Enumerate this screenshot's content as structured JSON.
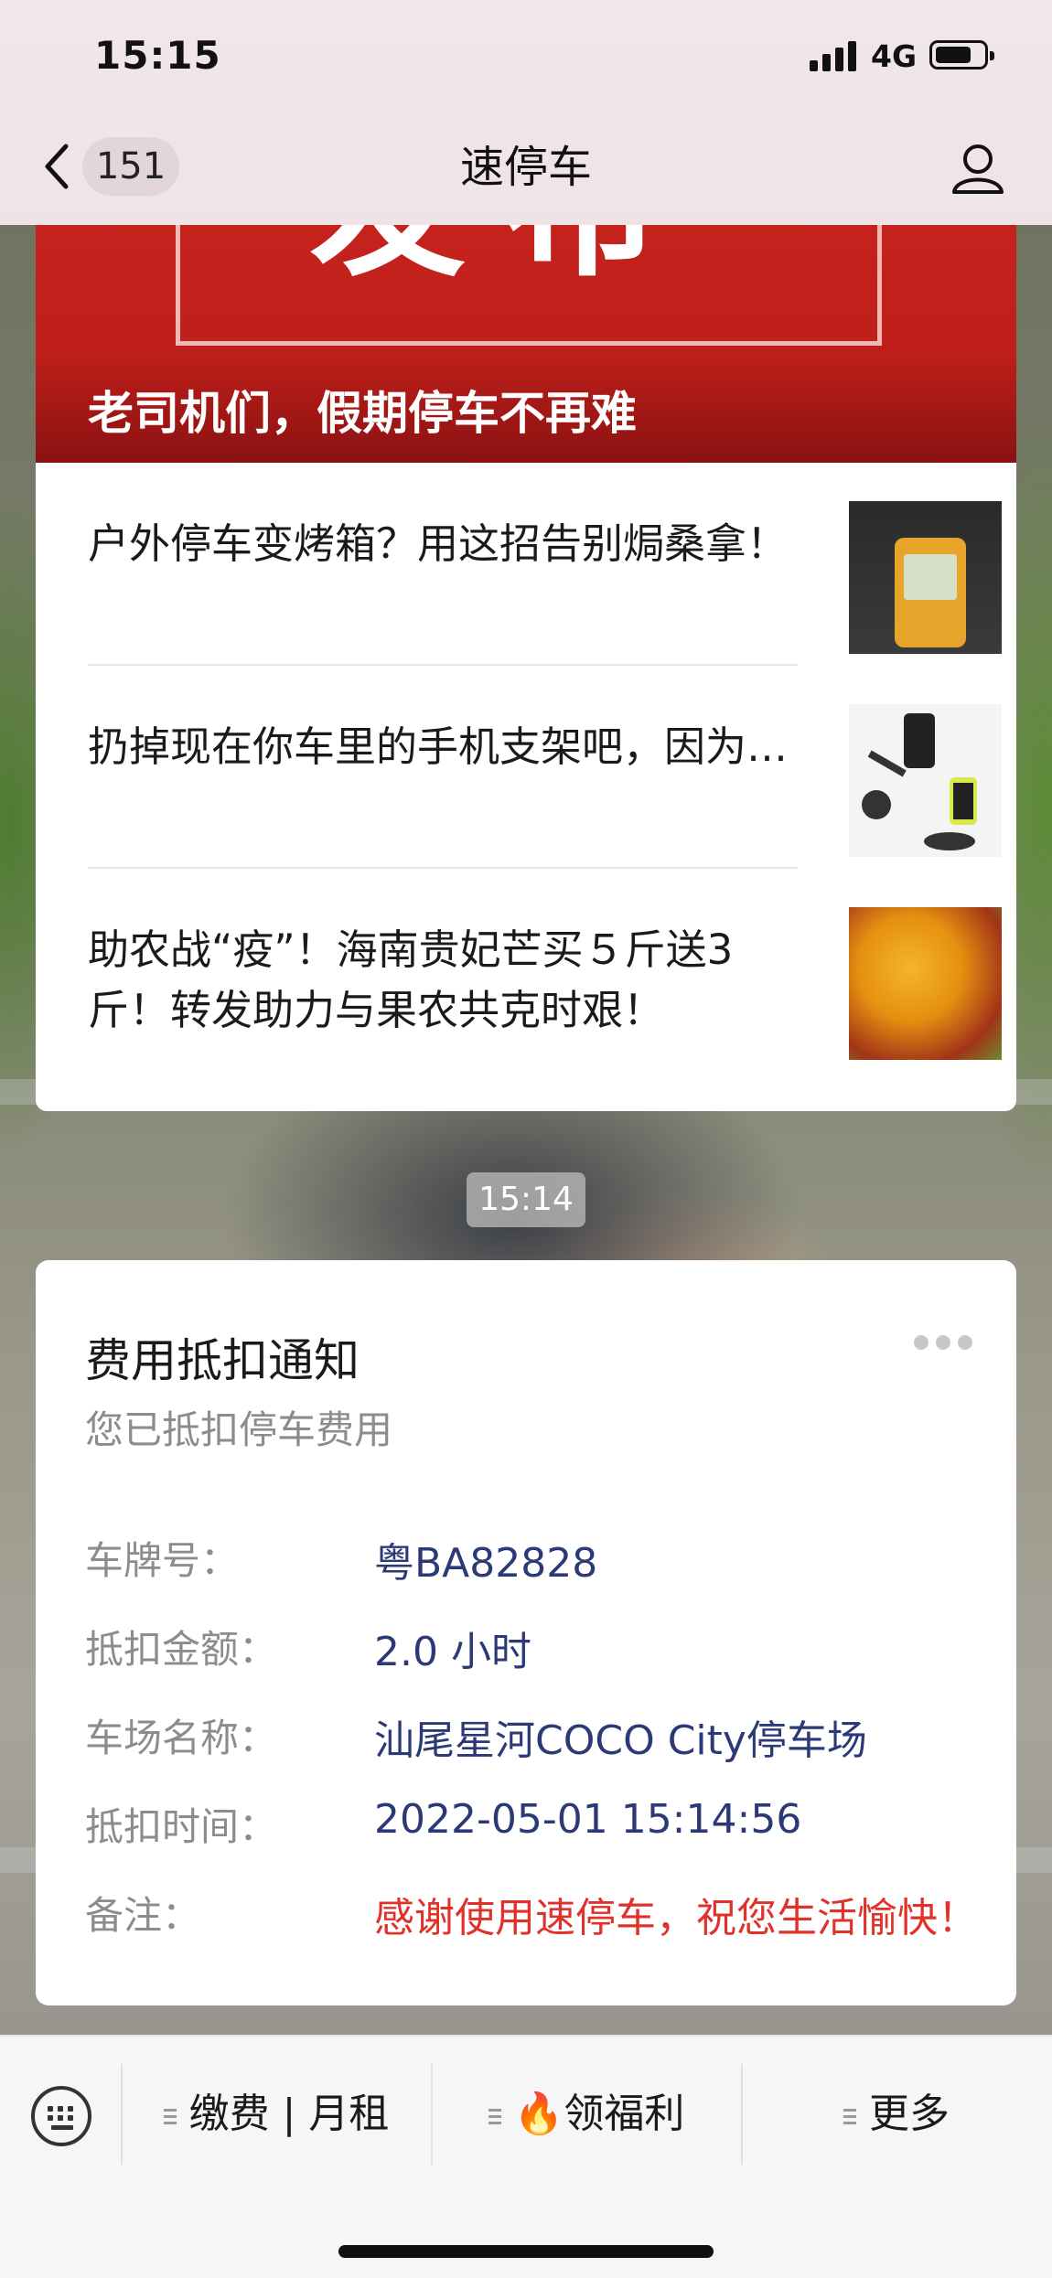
{
  "status_bar": {
    "time": "15:15",
    "network": "4G"
  },
  "nav": {
    "back_count": "151",
    "title": "速停车"
  },
  "article_card": {
    "banner_caption": "老司机们，假期停车不再难",
    "banner_text": "发布",
    "items": [
      {
        "title": "户外停车变烤箱？用这招告别焗桑拿！"
      },
      {
        "title": "扔掉现在你车里的手机支架吧，因为…"
      },
      {
        "title": "助农战“疫”！海南贵妃芒买５斤送3斤！转发助力与果农共克时艰！"
      }
    ]
  },
  "timestamp": "15:14",
  "notification": {
    "title": "费用抵扣通知",
    "subtitle": "您已抵扣停车费用",
    "rows": [
      {
        "label": "车牌号：",
        "value": "粤BA82828"
      },
      {
        "label": "抵扣金额：",
        "value": "2.0 小时"
      },
      {
        "label": "车场名称：",
        "value": "汕尾星河COCO City停车场"
      },
      {
        "label": "抵扣时间：",
        "value": "2022-05-01 15:14:56"
      },
      {
        "label": "备注：",
        "value": "感谢使用速停车，祝您生活愉快！"
      }
    ],
    "remark_color": "#e0312b",
    "value_color": "#2b3a77"
  },
  "bottom_menu": {
    "items": [
      {
        "label": "缴费 | 月租"
      },
      {
        "label": "🔥领福利"
      },
      {
        "label": "更多"
      }
    ]
  }
}
